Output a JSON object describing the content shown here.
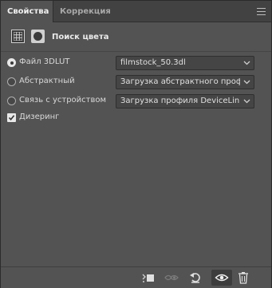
{
  "tabs": [
    {
      "label": "Свойства",
      "active": true
    },
    {
      "label": "Коррекция",
      "active": false
    }
  ],
  "header": {
    "title": "Поиск цвета"
  },
  "options": {
    "file_3dlut": {
      "label": "Файл 3DLUT",
      "selected": true,
      "value": "filmstock_50.3dl"
    },
    "abstract": {
      "label": "Абстрактный",
      "selected": false,
      "value": "Загрузка абстрактного профи..."
    },
    "device_link": {
      "label": "Связь с устройством",
      "selected": false,
      "value": "Загрузка профиля DeviceLink..."
    }
  },
  "dithering": {
    "label": "Дизеринг",
    "checked": true
  },
  "toolbar": {
    "icons": [
      "clip-to-layer-icon",
      "view-previous-state-icon",
      "reset-icon",
      "visibility-eye-icon",
      "trash-icon"
    ]
  },
  "colors": {
    "panel_bg": "#535353",
    "tabbar_bg": "#424242",
    "dropdown_bg": "#454545",
    "text": "#d6d6d6"
  }
}
